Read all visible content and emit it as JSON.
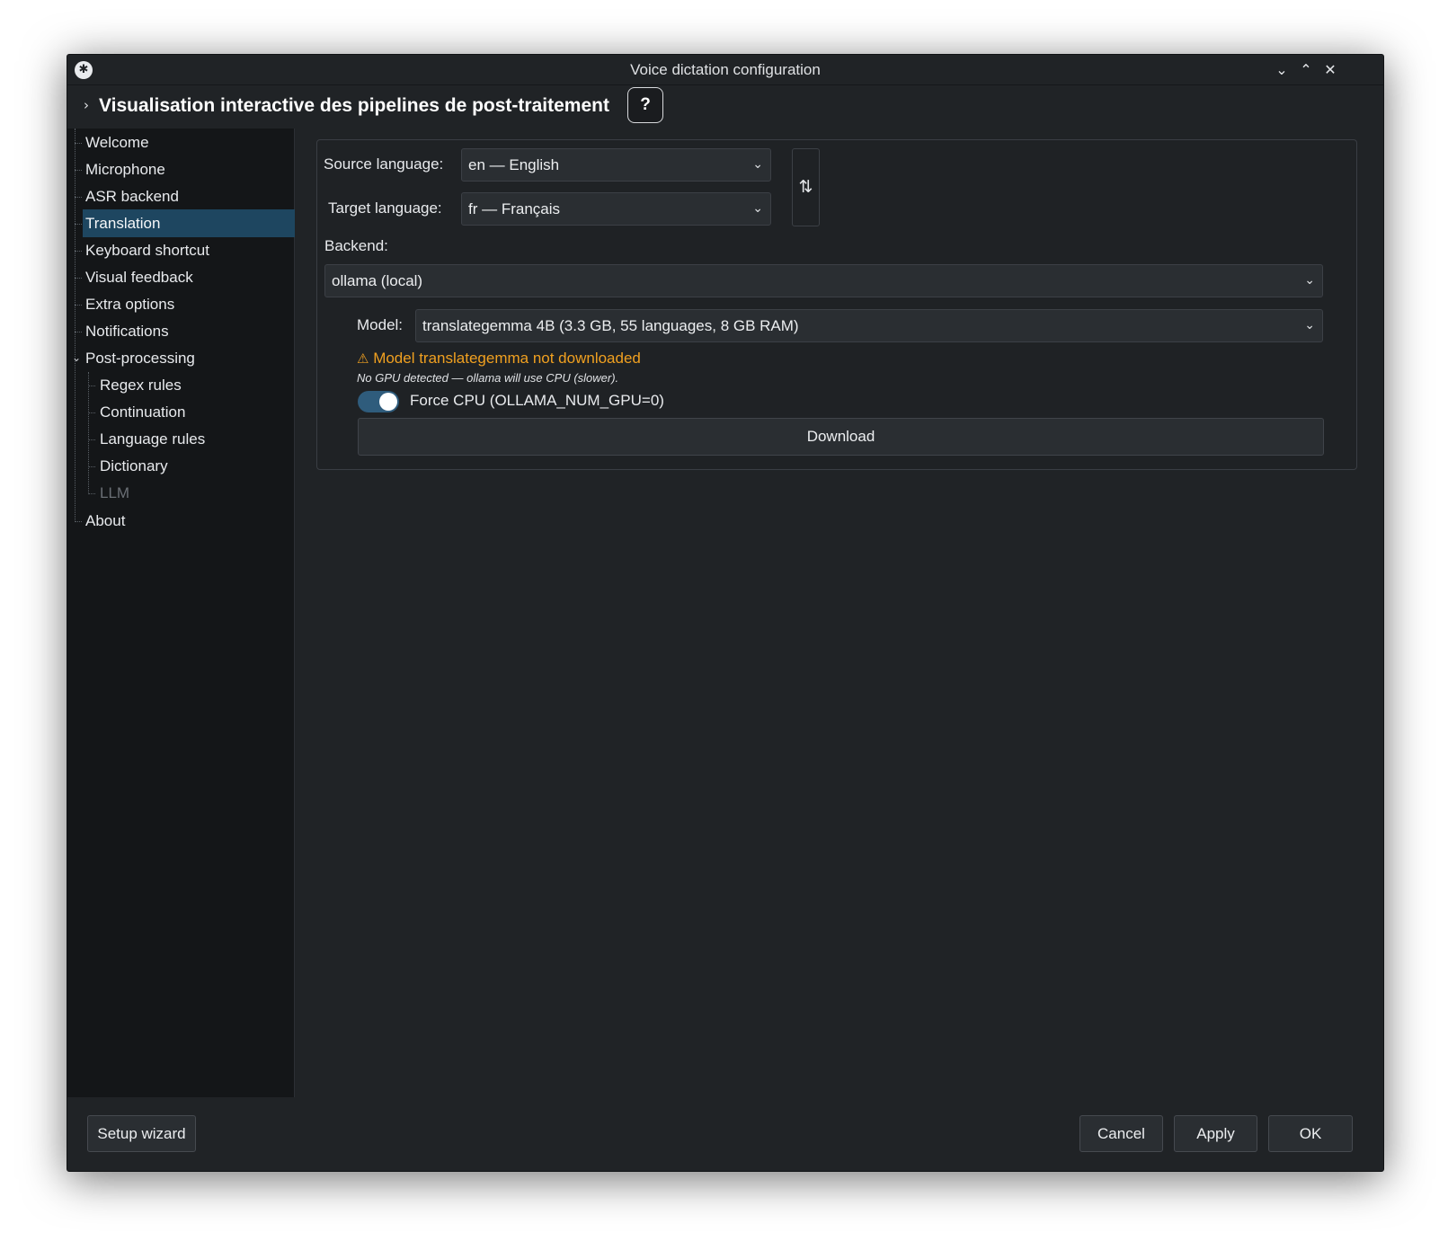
{
  "window": {
    "title": "Voice dictation configuration",
    "app_icon_glyph": "✱",
    "minimize_glyph": "⌄",
    "maximize_glyph": "⌃",
    "close_glyph": "✕"
  },
  "header": {
    "expand_glyph": "›",
    "title": "Visualisation interactive des pipelines de post-traitement",
    "help_label": "?"
  },
  "sidebar": {
    "items": [
      {
        "label": "Welcome"
      },
      {
        "label": "Microphone"
      },
      {
        "label": "ASR backend"
      },
      {
        "label": "Translation",
        "selected": true
      },
      {
        "label": "Keyboard shortcut"
      },
      {
        "label": "Visual feedback"
      },
      {
        "label": "Extra options"
      },
      {
        "label": "Notifications"
      },
      {
        "label": "Post-processing",
        "expanded": true
      },
      {
        "label": "Regex rules"
      },
      {
        "label": "Continuation"
      },
      {
        "label": "Language rules"
      },
      {
        "label": "Dictionary"
      },
      {
        "label": "LLM",
        "disabled": true
      },
      {
        "label": "About"
      }
    ],
    "expanded_glyph": "⌄"
  },
  "translation": {
    "source_language_label": "Source language:",
    "source_language_value": "en — English",
    "target_language_label": "Target language:",
    "target_language_value": "fr — Français",
    "swap_glyph": "⇅",
    "backend_label": "Backend:",
    "backend_value": "ollama (local)",
    "model_label": "Model:",
    "model_value": "translategemma 4B (3.3 GB, 55 languages, 8 GB RAM)",
    "warning_icon": "⚠",
    "warning_text": "Model translategemma not downloaded",
    "note_text": "No GPU detected — ollama will use CPU (slower).",
    "force_cpu_label": "Force CPU (OLLAMA_NUM_GPU=0)",
    "force_cpu_enabled": true,
    "download_label": "Download",
    "caret_glyph": "⌄"
  },
  "footer": {
    "setup_wizard_label": "Setup wizard",
    "cancel_label": "Cancel",
    "apply_label": "Apply",
    "ok_label": "OK"
  },
  "colors": {
    "window_bg": "#202326",
    "sidebar_bg": "#141618",
    "selection": "#1e4660",
    "warning": "#f0a020",
    "toggle_on": "#2f5c7c"
  }
}
